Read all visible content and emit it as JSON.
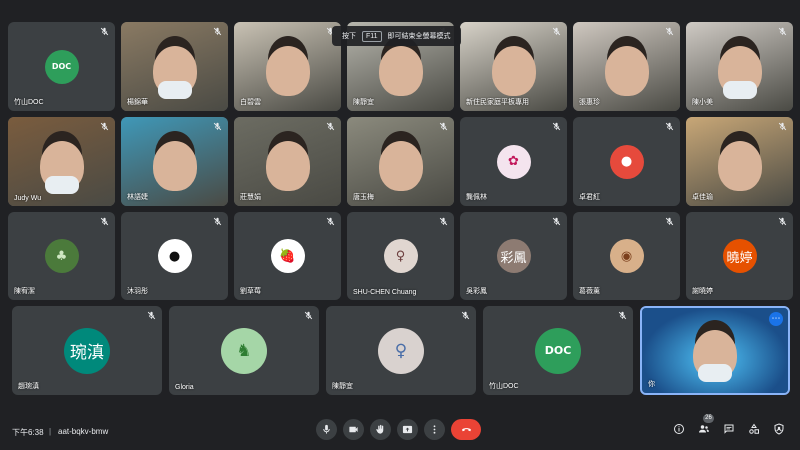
{
  "toast": {
    "prefix": "按下",
    "key": "F11",
    "suffix": "即可結束全螢幕模式"
  },
  "participants": [
    {
      "name": "竹山DOC",
      "kind": "logo",
      "logo_text": "DOC",
      "bg": "#3c4043"
    },
    {
      "name": "楊錦華",
      "kind": "video",
      "bg": "#8a7a63",
      "mask": true
    },
    {
      "name": "白碧雲",
      "kind": "video",
      "bg": "#c9c2b4"
    },
    {
      "name": "陳靜宜",
      "kind": "video",
      "bg": "#b7b6ad"
    },
    {
      "name": "新住民家庭平板專用",
      "kind": "video",
      "bg": "#d7d2c8"
    },
    {
      "name": "張惠珍",
      "kind": "video",
      "bg": "#cfc8c0"
    },
    {
      "name": "陳小美",
      "kind": "video",
      "bg": "#cfcac4",
      "mask": true
    },
    {
      "name": "Judy Wu",
      "kind": "video",
      "bg": "#7a5c3e",
      "mask": true
    },
    {
      "name": "林語婕",
      "kind": "video",
      "bg": "#3f98b8"
    },
    {
      "name": "莊慧娟",
      "kind": "video",
      "bg": "#6c6c62"
    },
    {
      "name": "唐玉梅",
      "kind": "video",
      "bg": "#8b8a7d"
    },
    {
      "name": "龔佩林",
      "kind": "avatar",
      "avatar_bg": "#f4e4ee",
      "avatar_text": "✿",
      "avatar_color": "#c2185b"
    },
    {
      "name": "卓君紅",
      "kind": "avatar",
      "avatar_bg": "#e64a3c",
      "avatar_text": "●",
      "avatar_color": "#ffffff"
    },
    {
      "name": "卓佳瑜",
      "kind": "video",
      "bg": "#c8a777"
    },
    {
      "name": "陳宥潔",
      "kind": "avatar",
      "avatar_bg": "#4b7a3b",
      "avatar_text": "♣",
      "avatar_color": "#cfe8c2"
    },
    {
      "name": "沐羽彤",
      "kind": "avatar",
      "avatar_bg": "#ffffff",
      "avatar_text": "●",
      "avatar_color": "#111111"
    },
    {
      "name": "劉草莓",
      "kind": "avatar",
      "avatar_bg": "#ffffff",
      "avatar_text": "🍓",
      "avatar_color": "#d32f2f"
    },
    {
      "name": "SHU-CHEN Chuang",
      "kind": "avatar",
      "avatar_bg": "#e0d6d0",
      "avatar_text": "♀",
      "avatar_color": "#6b3e3e"
    },
    {
      "name": "吳彩鳳",
      "kind": "avatar",
      "avatar_bg": "#8d7b72",
      "avatar_text": "彩鳳",
      "avatar_color": "#ffffff"
    },
    {
      "name": "葛薇薰",
      "kind": "avatar",
      "avatar_bg": "#d8b08a",
      "avatar_text": "◉",
      "avatar_color": "#7b3f1c"
    },
    {
      "name": "謝曉婷",
      "kind": "avatar",
      "avatar_bg": "#e65100",
      "avatar_text": "曉婷",
      "avatar_color": "#ffffff"
    },
    {
      "name": "趙琬滇",
      "kind": "avatar",
      "big": true,
      "avatar_bg": "#00897b",
      "avatar_text": "琬滇",
      "avatar_color": "#ffffff"
    },
    {
      "name": "Gloria",
      "kind": "avatar",
      "big": true,
      "avatar_bg": "#a5d6a7",
      "avatar_text": "♞",
      "avatar_color": "#2e7d32"
    },
    {
      "name": "陳靜宜",
      "kind": "avatar",
      "big": true,
      "avatar_bg": "#d9d2cf",
      "avatar_text": "♀",
      "avatar_color": "#4a6ea8"
    },
    {
      "name": "竹山DOC",
      "kind": "logo",
      "big": true,
      "logo_text": "DOC",
      "bg": "#3c4043"
    },
    {
      "name": "你",
      "kind": "self",
      "bg": "#1b4f8a",
      "mask": true
    }
  ],
  "bottom_bar": {
    "time": "下午6:38",
    "separator": "|",
    "meeting_code": "aat-bqkv-bmw",
    "participant_count": "26"
  },
  "icons": {
    "mic": "mic-off-icon",
    "controls": [
      "microphone-icon",
      "camera-icon",
      "raise-hand-icon",
      "present-screen-icon",
      "more-options-icon",
      "hang-up-icon"
    ],
    "right": [
      "info-icon",
      "people-icon",
      "chat-icon",
      "activities-icon",
      "host-controls-icon"
    ]
  },
  "colors": {
    "background": "#202124",
    "tile": "#3c4043",
    "hangup": "#ea4335",
    "self_border": "#8ab4f8"
  }
}
